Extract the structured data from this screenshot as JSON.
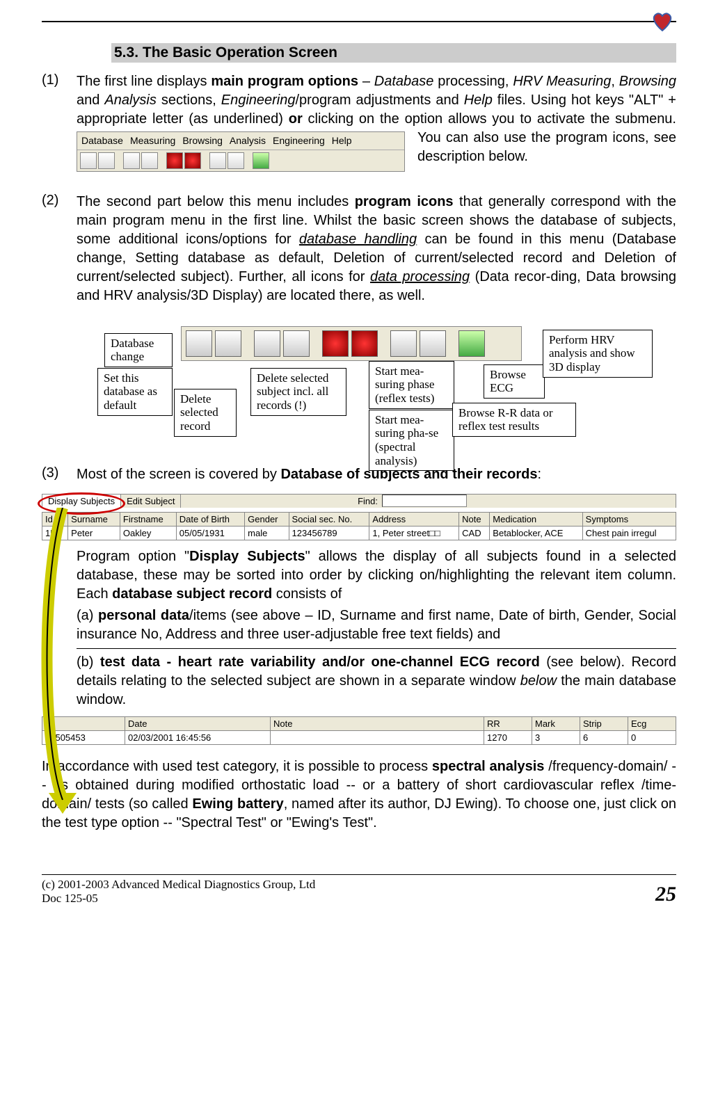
{
  "section": {
    "number": "5.3.",
    "title": "The Basic Operation Screen"
  },
  "para1": {
    "num": "(1)",
    "t1": "The first line displays ",
    "t2": "main program options",
    "t3": " – ",
    "t4": "Database",
    "t5": " processing, ",
    "t6": "HRV Measuring",
    "t7": ", ",
    "t8": "Browsing",
    "t9": " and ",
    "t10": "Analysis",
    "t11": " sections, ",
    "t12": "Engineering",
    "t13": "/program adjustments and ",
    "t14": "Help",
    "t15": " files. Using hot keys \"ALT\" + appropriate letter (as underlined) ",
    "t16": "or",
    "t17": " clicking on the option allows you to activate the submenu. You can also use the program icons, see description below."
  },
  "menubar": [
    "Database",
    "Measuring",
    "Browsing",
    "Analysis",
    "Engineering",
    "Help"
  ],
  "para2": {
    "num": "(2)",
    "t1": "The second part below this menu includes ",
    "t2": "program icons",
    "t3": " that generally correspond with the main program menu in the first line. Whilst the basic screen shows the database of subjects, some additional icons/options for ",
    "t4": "database handling",
    "t5": " can be found in this menu (Database change, Setting database as default, Deletion of current/selected record and Deletion of current/selected subject). Further, all icons for ",
    "t6": "data processing",
    "t7": " (Data recor-ding, Data browsing and HRV analysis/3D Display) are located there, as well."
  },
  "callouts": {
    "c1": "Database change",
    "c2": "Set this database as default",
    "c3": "Delete selected record",
    "c4": "Delete selected subject incl. all records (!)",
    "c5": "Start mea-suring phase (reflex tests)",
    "c6": "Start mea-suring pha-se (spectral analysis)",
    "c7": "Browse R-R data  or reflex test results",
    "c8": "Browse ECG",
    "c9": "Perform HRV analysis and show 3D display"
  },
  "para3": {
    "num": "(3)",
    "t1": "Most of the screen is covered by ",
    "t2": "Database of subjects and their records",
    "t3": ":"
  },
  "tabs": {
    "t1": "Display Subjects",
    "t2": "Edit Subject",
    "find": "Find:"
  },
  "table1": {
    "headers": [
      "Id",
      "Surname",
      "Firstname",
      "Date of Birth",
      "Gender",
      "Social sec. No.",
      "Address",
      "Note",
      "Medication",
      "Symptoms"
    ],
    "row": [
      "153",
      "Peter",
      "Oakley",
      "05/05/1931",
      "male",
      "123456789",
      "1, Peter street□□",
      "CAD",
      "Betablocker, ACE",
      "Chest pain irregul"
    ]
  },
  "sub1": {
    "t1": "Program option \"",
    "t2": "Display Subjects",
    "t3": "\" allows the display of all subjects found in a selected database, these may be sorted into order by clicking on/highlighting the relevant item column. Each ",
    "t4": "database subject record",
    "t5": " consists of"
  },
  "sub_a": {
    "letter": "(a) ",
    "t1": "personal data",
    "t2": "/items (see above – ID, Surname and first name, Date of birth, Gender, Social insurance No, Address and three user-adjustable free text fields) and"
  },
  "sub_b": {
    "letter": "(b) ",
    "t1": "test data - heart rate variability and/or one-channel ECG record",
    "t2": " (see below). Record details relating to the selected subject are shown in a separate window ",
    "t3": "below",
    "t4": " the main database window."
  },
  "table2": {
    "headers": [
      "Id",
      "Date",
      "Note",
      "RR",
      "Mark",
      "Strip",
      "Ecg"
    ],
    "row": [
      "30505453",
      "02/03/2001 16:45:56",
      "",
      "1270",
      "3",
      "6",
      "0"
    ]
  },
  "bottom": {
    "t1": "In accordance with used test category, it is possible to process ",
    "t2": "spectral analysis",
    "t3": " /frequency-domain/ -- as obtained during modified orthostatic load -- or a battery of short cardiovascular reflex /time-domain/ tests (so called ",
    "t4": "Ewing battery",
    "t5": ", named after its author, DJ Ewing). To choose one, just click on the test type option -- \"Spectral Test\" or \"Ewing's Test\"."
  },
  "footer": {
    "line1": "(c) 2001-2003 Advanced Medical Diagnostics Group, Ltd",
    "line2": "Doc 125-05",
    "page": "25"
  }
}
